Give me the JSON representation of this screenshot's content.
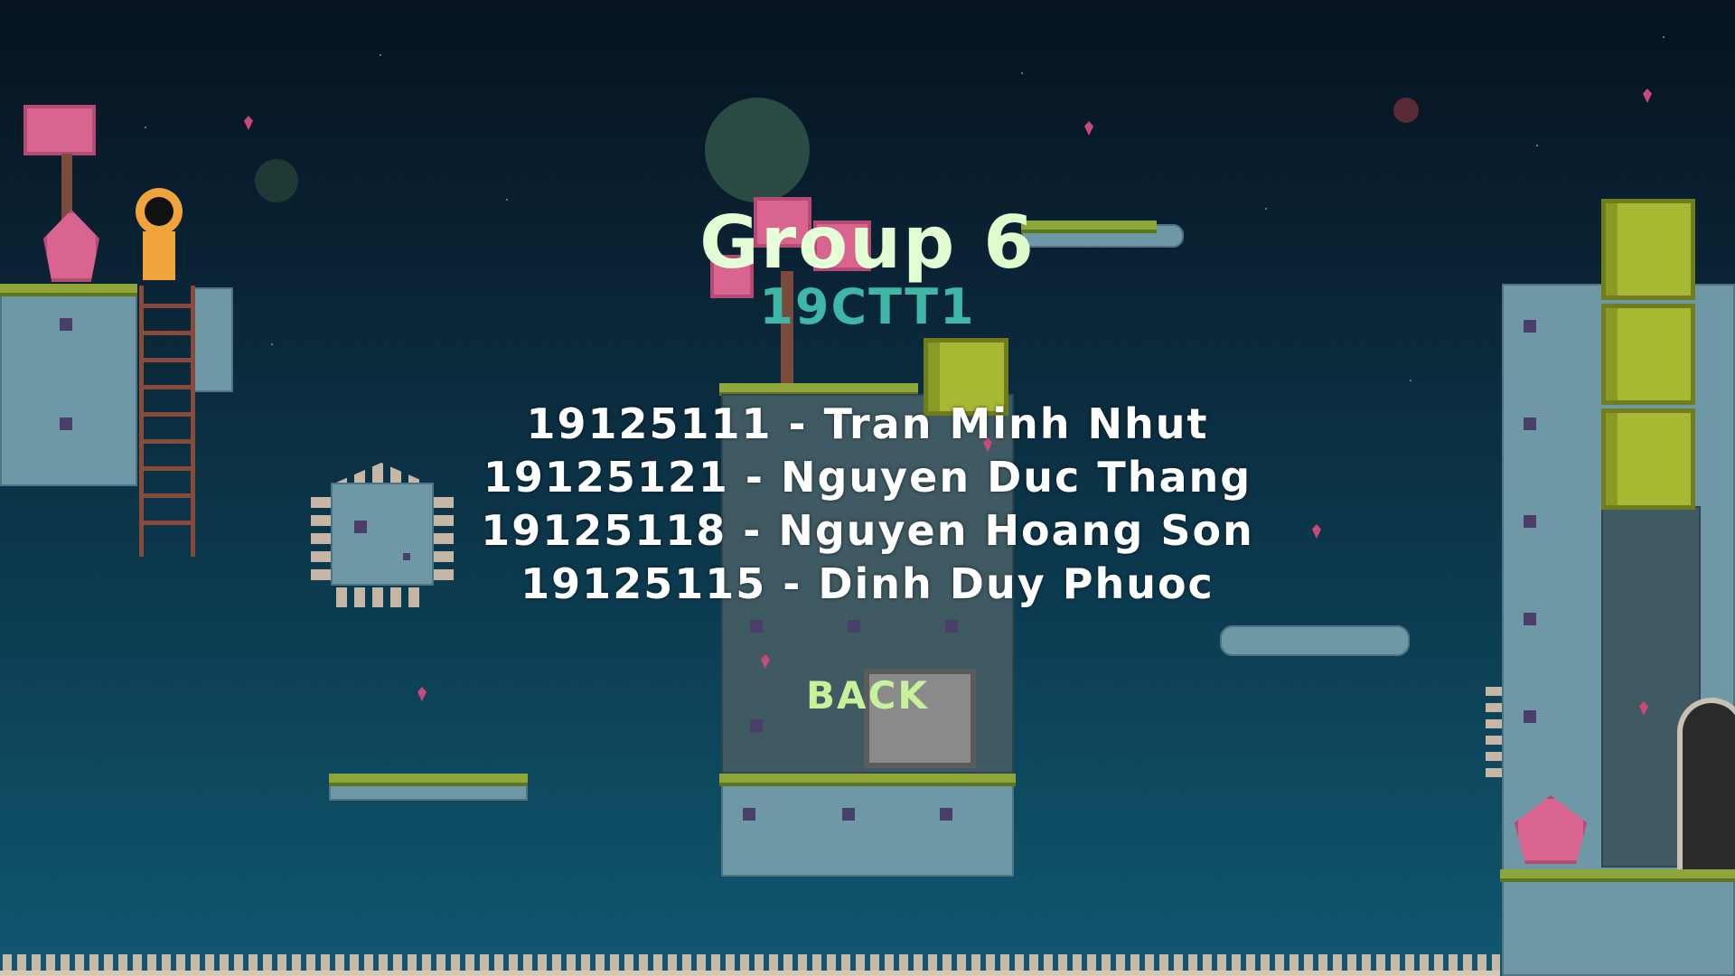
{
  "screen": {
    "title": "Group 6",
    "subtitle": "19CTT1",
    "members": [
      "19125111 - Tran Minh Nhut",
      "19125121 - Nguyen Duc Thang",
      "19125118 - Nguyen Hoang Son",
      "19125115 - Dinh Duy Phuoc"
    ],
    "back_label": "BACK"
  },
  "colors": {
    "title": "#b8f0a8",
    "subtitle": "#3fb7a6",
    "members": "#ffffff",
    "back": "#c7f29a",
    "sky_top": "#06121f",
    "sky_bottom": "#0f5870"
  }
}
